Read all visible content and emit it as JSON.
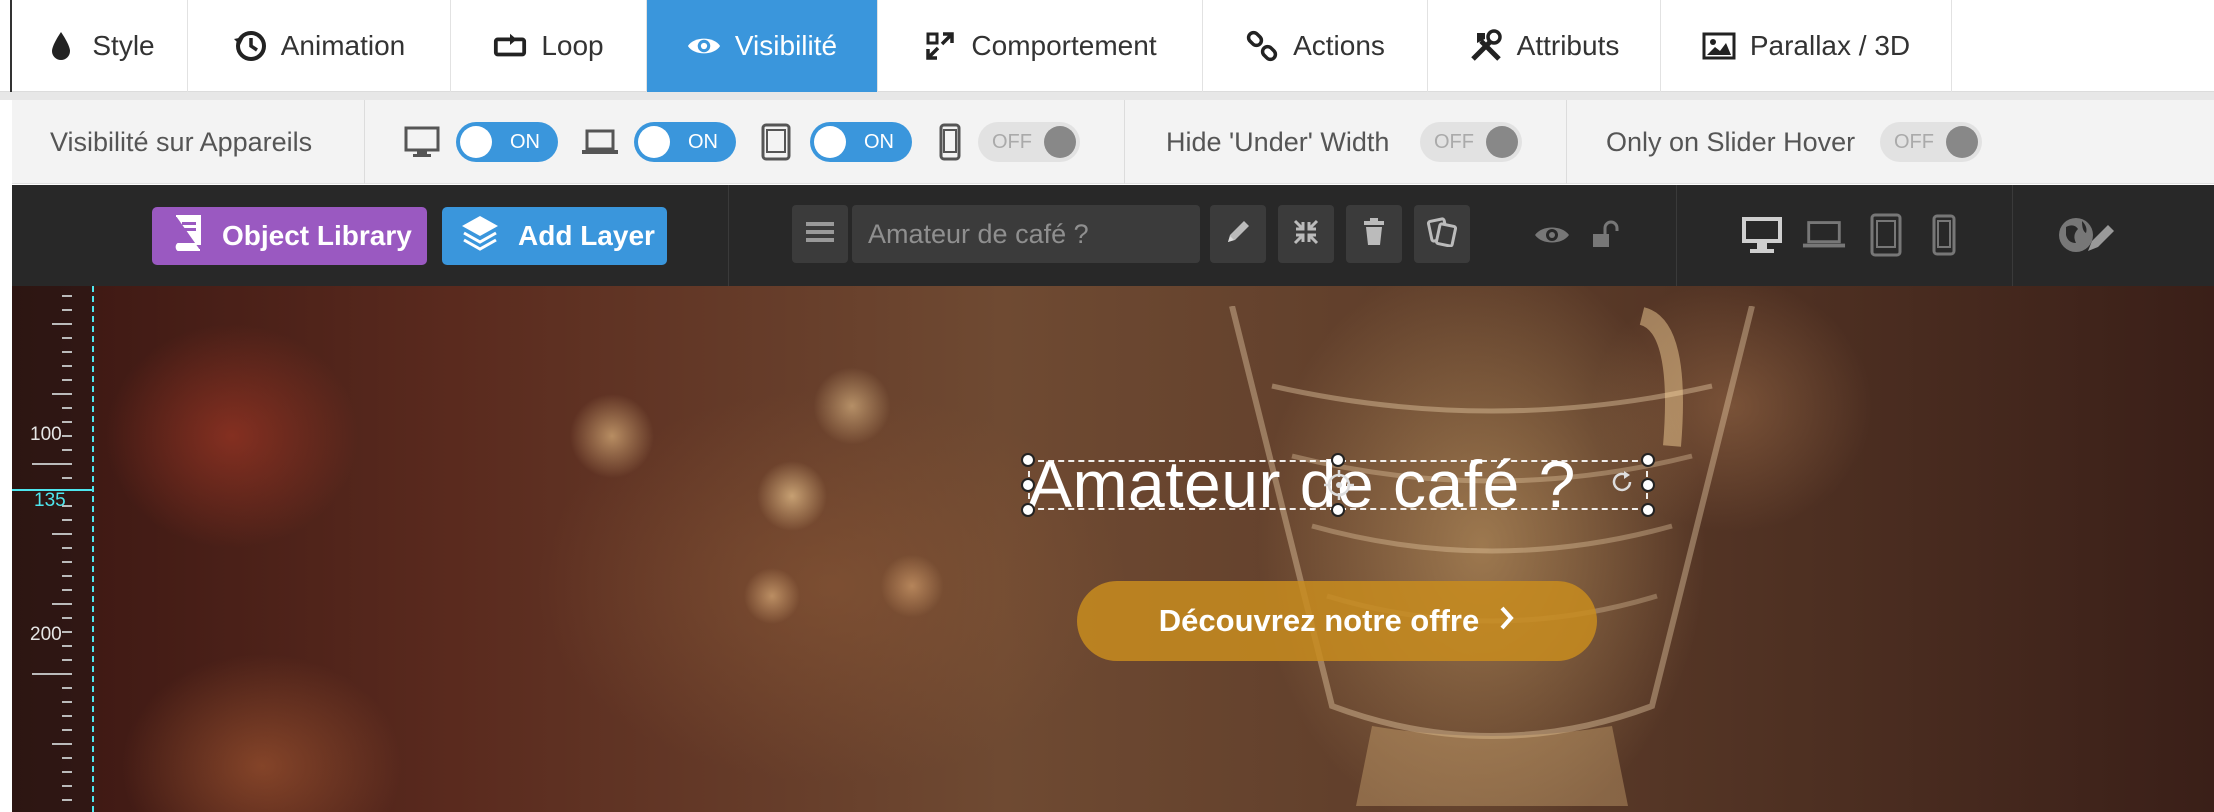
{
  "tabs": [
    {
      "label": "Style",
      "icon": "droplet-icon",
      "active": false
    },
    {
      "label": "Animation",
      "icon": "history-icon",
      "active": false
    },
    {
      "label": "Loop",
      "icon": "loop-icon",
      "active": false
    },
    {
      "label": "Visibilité",
      "icon": "eye-icon",
      "active": true
    },
    {
      "label": "Comportement",
      "icon": "expand-icon",
      "active": false
    },
    {
      "label": "Actions",
      "icon": "link-icon",
      "active": false
    },
    {
      "label": "Attributs",
      "icon": "tools-icon",
      "active": false
    },
    {
      "label": "Parallax / 3D",
      "icon": "image-icon",
      "active": false
    }
  ],
  "visibility": {
    "label": "Visibilité sur Appareils",
    "devices": [
      {
        "device": "desktop",
        "state": "ON"
      },
      {
        "device": "notebook",
        "state": "ON"
      },
      {
        "device": "tablet",
        "state": "ON"
      },
      {
        "device": "mobile",
        "state": "OFF"
      }
    ],
    "hide_under_width": {
      "label": "Hide 'Under' Width",
      "state": "OFF"
    },
    "only_on_slider_hover": {
      "label": "Only on Slider Hover",
      "state": "OFF"
    }
  },
  "toolbar": {
    "object_library": "Object Library",
    "add_layer": "Add Layer",
    "layer_name": "Amateur de café ?",
    "colors": {
      "library": "#9a59c1",
      "add_layer": "#3a96dc",
      "toolbar_bg": "#282828"
    }
  },
  "ruler": {
    "labels": [
      "100",
      "135",
      "200"
    ],
    "active": "135"
  },
  "canvas": {
    "headline": "Amateur de café ?",
    "cta": "Découvrez notre offre"
  },
  "colors": {
    "accent": "#3a96dc",
    "guide": "#4ee6ee",
    "cta": "#c88c1e"
  }
}
